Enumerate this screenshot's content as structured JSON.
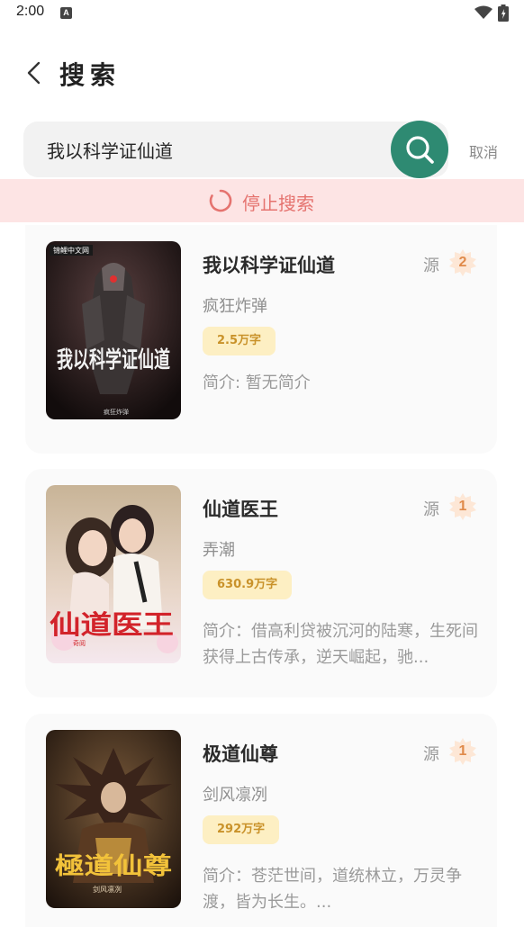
{
  "status_bar": {
    "time": "2:00",
    "notification_icon": "a-letter-icon",
    "wifi_icon": "wifi-icon",
    "battery_icon": "battery-icon"
  },
  "header": {
    "back_icon": "chevron-left-icon",
    "title": "搜索"
  },
  "search": {
    "query": "我以科学证仙道",
    "search_icon": "magnifier-icon",
    "cancel_label": "取消"
  },
  "stop_banner": {
    "label": "停止搜索",
    "spinner_icon": "loading-spinner-icon"
  },
  "results": [
    {
      "title": "我以科学证仙道",
      "author": "疯狂炸弹",
      "words": "2.5万字",
      "intro": "简介: 暂无简介",
      "source_label": "源",
      "source_count": "2",
      "cover": {
        "publisher": "锦鲤中文网",
        "title_art": "我以科学证仙道",
        "author_art": "疯狂炸弹"
      }
    },
    {
      "title": "仙道医王",
      "author": "弄潮",
      "words": "630.9万字",
      "intro": "简介：借高利贷被沉河的陆寒，生死间获得上古传承，逆天崛起，驰...",
      "source_label": "源",
      "source_count": "1",
      "cover": {
        "title_art": "仙道医王",
        "publisher": "奇阅"
      }
    },
    {
      "title": "极道仙尊",
      "author": "剑风凛冽",
      "words": "292万字",
      "intro": "简介：苍茫世间，道统林立，万灵争渡，皆为长生。...",
      "source_label": "源",
      "source_count": "1",
      "cover": {
        "title_art": "極道仙尊",
        "author_art": "剑风凛冽"
      }
    }
  ],
  "colors": {
    "accent_green": "#2e8a72",
    "banner_bg": "#fde4e4",
    "banner_text": "#e5736f",
    "badge_bg": "#fdefc3",
    "badge_text": "#c9922a",
    "source_badge": "#e08a4a"
  }
}
